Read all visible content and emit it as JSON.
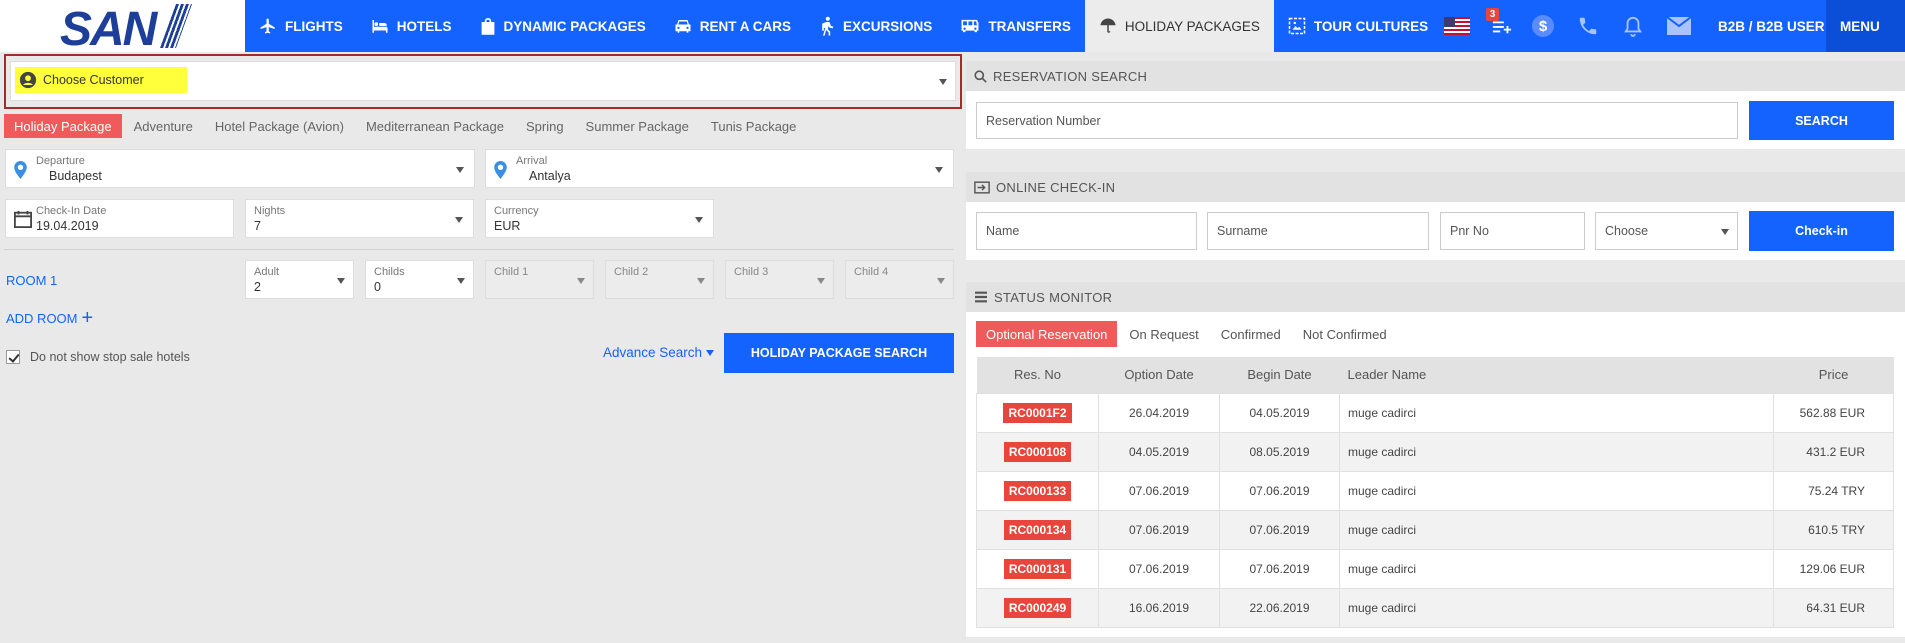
{
  "header": {
    "logo": "SAN",
    "nav": [
      {
        "label": "FLIGHTS",
        "icon": "plane-icon"
      },
      {
        "label": "HOTELS",
        "icon": "bed-icon"
      },
      {
        "label": "DYNAMIC PACKAGES",
        "icon": "bag-icon"
      },
      {
        "label": "RENT A CARS",
        "icon": "car-icon"
      },
      {
        "label": "EXCURSIONS",
        "icon": "hiker-icon"
      },
      {
        "label": "TRANSFERS",
        "icon": "bus-icon"
      },
      {
        "label": "HOLIDAY PACKAGES",
        "icon": "umbrella-icon"
      },
      {
        "label": "TOUR CULTURES",
        "icon": "image-icon"
      }
    ],
    "active_nav": "HOLIDAY PACKAGES",
    "cart_badge": "3",
    "user_label": "B2B / B2B USER",
    "menu_label": "MENU"
  },
  "customer": {
    "label": "Choose Customer"
  },
  "package_tabs": [
    "Holiday Package",
    "Adventure",
    "Hotel Package (Avion)",
    "Mediterranean Package",
    "Spring",
    "Summer Package",
    "Tunis Package"
  ],
  "search": {
    "departure_label": "Departure",
    "departure_value": "Budapest",
    "arrival_label": "Arrival",
    "arrival_value": "Antalya",
    "checkin_label": "Check-In Date",
    "checkin_value": "19.04.2019",
    "nights_label": "Nights",
    "nights_value": "7",
    "currency_label": "Currency",
    "currency_value": "EUR",
    "room_label": "ROOM 1",
    "adult_label": "Adult",
    "adult_value": "2",
    "childs_label": "Childs",
    "childs_value": "0",
    "child1_label": "Child 1",
    "child2_label": "Child 2",
    "child3_label": "Child 3",
    "child4_label": "Child 4",
    "add_room": "ADD ROOM",
    "stop_sale": "Do not show stop sale hotels",
    "advance_search": "Advance Search",
    "submit": "HOLIDAY PACKAGE SEARCH"
  },
  "reservation_search": {
    "title": "RESERVATION SEARCH",
    "placeholder": "Reservation Number",
    "button": "SEARCH"
  },
  "checkin": {
    "title": "ONLINE CHECK-IN",
    "name_placeholder": "Name",
    "surname_placeholder": "Surname",
    "pnr_placeholder": "Pnr No",
    "choose": "Choose",
    "button": "Check-in"
  },
  "status": {
    "title": "STATUS MONITOR",
    "tabs": [
      "Optional Reservation",
      "On Request",
      "Confirmed",
      "Not Confirmed"
    ],
    "columns": [
      "Res. No",
      "Option Date",
      "Begin Date",
      "Leader Name",
      "Price"
    ],
    "rows": [
      {
        "res": "RC0001F2",
        "opt": "26.04.2019",
        "begin": "04.05.2019",
        "leader": "muge cadirci",
        "price": "562.88 EUR"
      },
      {
        "res": "RC000108",
        "opt": "04.05.2019",
        "begin": "08.05.2019",
        "leader": "muge cadirci",
        "price": "431.2 EUR"
      },
      {
        "res": "RC000133",
        "opt": "07.06.2019",
        "begin": "07.06.2019",
        "leader": "muge cadirci",
        "price": "75.24 TRY"
      },
      {
        "res": "RC000134",
        "opt": "07.06.2019",
        "begin": "07.06.2019",
        "leader": "muge cadirci",
        "price": "610.5 TRY"
      },
      {
        "res": "RC000131",
        "opt": "07.06.2019",
        "begin": "07.06.2019",
        "leader": "muge cadirci",
        "price": "129.06 EUR"
      },
      {
        "res": "RC000249",
        "opt": "16.06.2019",
        "begin": "22.06.2019",
        "leader": "muge cadirci",
        "price": "64.31 EUR"
      }
    ]
  },
  "colors": {
    "primary": "#1463ff",
    "accent": "#f05a5a",
    "highlight": "#ffff3c"
  }
}
